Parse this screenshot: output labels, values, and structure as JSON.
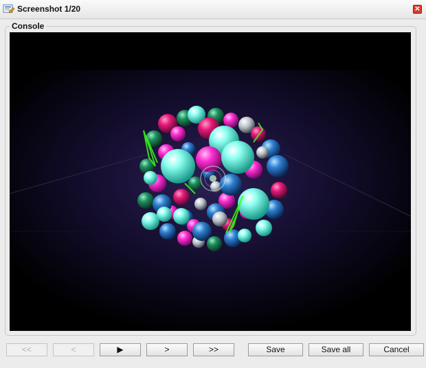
{
  "window": {
    "title": "Screenshot 1/20",
    "close_glyph": "✕"
  },
  "console": {
    "label": "Console"
  },
  "toolbar": {
    "first_label": "<<",
    "prev_label": "<",
    "play_label": "▶",
    "next_label": ">",
    "last_label": ">>",
    "save_label": "Save",
    "save_all_label": "Save all",
    "cancel_label": "Cancel"
  },
  "colors": {
    "cyan": "#7fffe8",
    "magenta": "#ff2fd2",
    "pink": "#e6197a",
    "blue": "#2f7fcf",
    "green": "#1f8f5f",
    "neon_green": "#39ff14"
  }
}
